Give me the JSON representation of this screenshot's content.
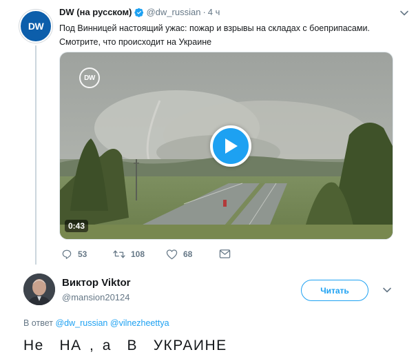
{
  "tweet": {
    "avatar_logo": "DW",
    "author_name": "DW (на русском)",
    "verified": true,
    "handle": "@dw_russian",
    "separator": "·",
    "time": "4 ч",
    "text": "Под Винницей настоящий ужас: пожар и взрывы на складах с боеприпасами. Смотрите, что происходит на Украине",
    "video": {
      "watermark": "DW",
      "duration": "0:43"
    },
    "actions": {
      "reply_count": "53",
      "retweet_count": "108",
      "like_count": "68"
    }
  },
  "reply": {
    "author_name": "Виктор Viktor",
    "handle": "@mansion20124",
    "follow_label": "Читать",
    "reply_to_prefix": "В ответ",
    "mentions": [
      "@dw_russian",
      "@vilnezheettya"
    ],
    "text": "Не  НА , а  В  УКРАИНЕ"
  },
  "colors": {
    "accent": "#1da1f2",
    "dw_blue": "#0c5eab",
    "muted": "#657786"
  },
  "icons": [
    "verified-icon",
    "caret-down-icon",
    "play-icon",
    "reply-icon",
    "retweet-icon",
    "like-icon",
    "dm-icon"
  ]
}
